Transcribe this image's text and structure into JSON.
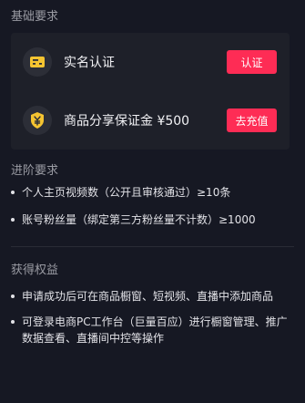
{
  "basic": {
    "title": "基础要求",
    "items": [
      {
        "icon": "id-card-icon",
        "label": "实名认证",
        "button": "认证"
      },
      {
        "icon": "yen-shield-icon",
        "label": "商品分享保证金 ¥500",
        "button": "去充值"
      }
    ]
  },
  "advanced": {
    "title": "进阶要求",
    "items": [
      "个人主页视频数（公开且审核通过）≥10条",
      "账号粉丝量（绑定第三方粉丝量不计数）≥1000"
    ]
  },
  "benefits": {
    "title": "获得权益",
    "items": [
      "申请成功后可在商品橱窗、短视频、直播中添加商品",
      "可登录电商PC工作台（巨量百应）进行橱窗管理、推广数据查看、直播间中控等操作"
    ]
  },
  "colors": {
    "background": "#161823",
    "card": "#1e2029",
    "accent": "#fe2c55",
    "icon": "#f5c431"
  }
}
